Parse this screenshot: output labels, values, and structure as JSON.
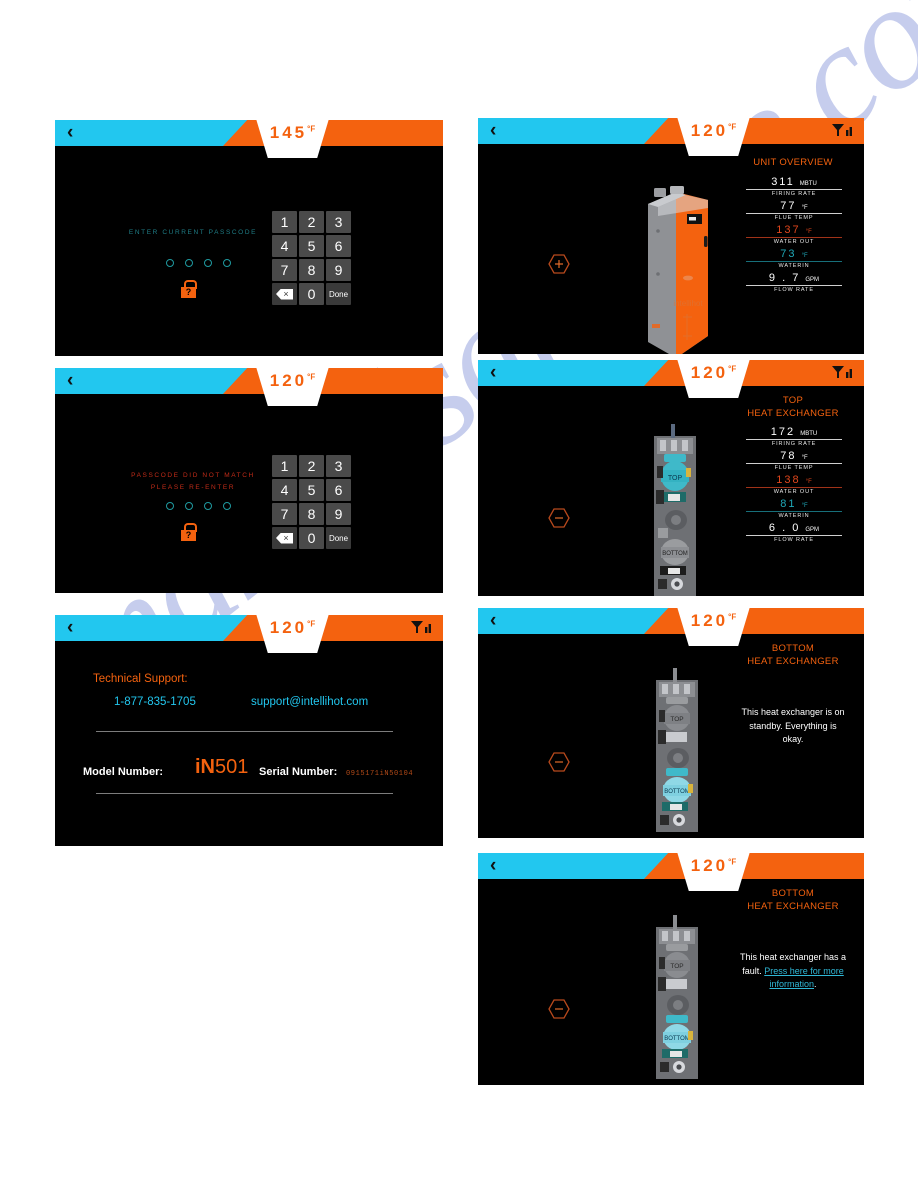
{
  "watermark": "manualsarchive.com",
  "panels": [
    {
      "id": "enter-passcode",
      "header": {
        "temp": "145",
        "deg": "°F",
        "back_icon": "chevron-left-icon",
        "signal_icon": "signal-icon",
        "signal_visible": false
      },
      "prompt": "ENTER CURRENT PASSCODE",
      "prompt_color": "#1f7d86",
      "dots": 4,
      "lock_icon": "lock-question-icon",
      "keypad": [
        "1",
        "2",
        "3",
        "4",
        "5",
        "6",
        "7",
        "8",
        "9",
        "backspace",
        "0",
        "Done"
      ]
    },
    {
      "id": "passcode-mismatch",
      "header": {
        "temp": "120",
        "deg": "°F",
        "back_icon": "chevron-left-icon",
        "signal_icon": "signal-icon",
        "signal_visible": false
      },
      "prompt_line1": "PASSCODE DID NOT MATCH",
      "prompt_line2": "PLEASE RE-ENTER",
      "prompt_color": "#c02b18",
      "dots": 4,
      "lock_icon": "lock-question-icon",
      "keypad": [
        "1",
        "2",
        "3",
        "4",
        "5",
        "6",
        "7",
        "8",
        "9",
        "backspace",
        "0",
        "Done"
      ]
    },
    {
      "id": "technical-support",
      "header": {
        "temp": "120",
        "deg": "°F",
        "back_icon": "chevron-left-icon",
        "signal_icon": "signal-icon",
        "signal_visible": true
      },
      "support_title": "Technical Support:",
      "phone": "1-877-835-1705",
      "email": "support@intellihot.com",
      "model_label": "Model Number:",
      "model_prefix": "iN",
      "model_number": "501",
      "serial_label": "Serial Number:",
      "serial_value": "0915171iN50104"
    },
    {
      "id": "unit-overview",
      "header": {
        "temp": "120",
        "deg": "°F",
        "back_icon": "chevron-left-icon",
        "signal_icon": "signal-icon",
        "signal_visible": true
      },
      "title": "UNIT OVERVIEW",
      "hex_button": "plus-hexagon-button",
      "hex_glyph": "+",
      "art": "boiler-exterior-image",
      "metrics": [
        {
          "value": "311",
          "unit": "MBTU",
          "caption": "FIRING RATE",
          "style": "white"
        },
        {
          "value": "77",
          "unit": "°F",
          "caption": "FLUE TEMP",
          "style": "white"
        },
        {
          "value": "137",
          "unit": "°F",
          "caption": "WATER OUT",
          "style": "out"
        },
        {
          "value": "73",
          "unit": "°F",
          "caption": "WATERIN",
          "style": "in"
        },
        {
          "value": "9 . 7",
          "unit": "GPM",
          "caption": "FLOW RATE",
          "style": "white"
        }
      ]
    },
    {
      "id": "top-heat-exchanger",
      "header": {
        "temp": "120",
        "deg": "°F",
        "back_icon": "chevron-left-icon",
        "signal_icon": "signal-icon",
        "signal_visible": true
      },
      "title_line1": "TOP",
      "title_line2": "HEAT EXCHANGER",
      "hex_button": "minus-hexagon-button",
      "hex_glyph": "−",
      "art": "heat-exchanger-top-highlighted-image",
      "metrics": [
        {
          "value": "172",
          "unit": "MBTU",
          "caption": "FIRING RATE",
          "style": "white"
        },
        {
          "value": "78",
          "unit": "°F",
          "caption": "FLUE TEMP",
          "style": "white"
        },
        {
          "value": "138",
          "unit": "°F",
          "caption": "WATER OUT",
          "style": "out"
        },
        {
          "value": "81",
          "unit": "°F",
          "caption": "WATERIN",
          "style": "in"
        },
        {
          "value": "6 . 0",
          "unit": "GPM",
          "caption": "FLOW RATE",
          "style": "white"
        }
      ]
    },
    {
      "id": "bottom-heat-exchanger-standby",
      "header": {
        "temp": "120",
        "deg": "°F",
        "back_icon": "chevron-left-icon",
        "signal_icon": "signal-icon",
        "signal_visible": false
      },
      "title_line1": "BOTTOM",
      "title_line2": "HEAT EXCHANGER",
      "hex_button": "minus-hexagon-button",
      "hex_glyph": "−",
      "art": "heat-exchanger-bottom-highlighted-image",
      "message": "This heat exchanger is on standby. Everything is okay."
    },
    {
      "id": "bottom-heat-exchanger-fault",
      "header": {
        "temp": "120",
        "deg": "°F",
        "back_icon": "chevron-left-icon",
        "signal_icon": "signal-icon",
        "signal_visible": false
      },
      "title_line1": "BOTTOM",
      "title_line2": "HEAT EXCHANGER",
      "hex_button": "minus-hexagon-button",
      "hex_glyph": "−",
      "art": "heat-exchanger-bottom-highlighted-image",
      "message_plain": "This heat exchanger has a fault.",
      "message_link": "Press here for more information",
      "message_tail": "."
    }
  ]
}
